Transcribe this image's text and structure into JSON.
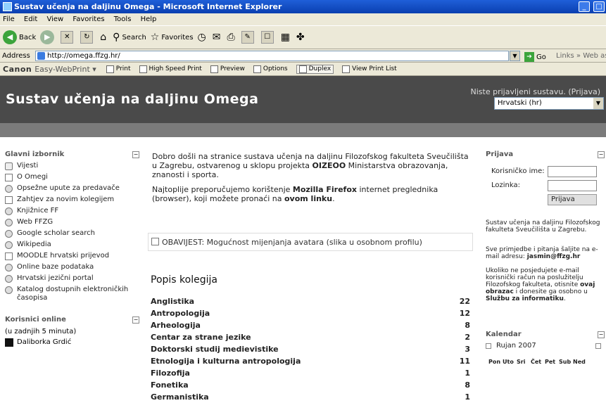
{
  "browser": {
    "title": "Sustav učenja na daljinu Omega - Microsoft Internet Explorer",
    "menu": [
      "File",
      "Edit",
      "View",
      "Favorites",
      "Tools",
      "Help"
    ],
    "toolbar": {
      "back": "Back",
      "search": "Search",
      "favorites": "Favorites"
    },
    "address_label": "Address",
    "address_value": "http://omega.ffzg.hr/",
    "go_label": "Go",
    "links_label": "Links",
    "web_assistant": "Web assistant"
  },
  "canon": {
    "brand": "Canon",
    "product": "Easy-WebPrint",
    "buttons": [
      "Print",
      "High Speed Print",
      "Preview",
      "Options",
      "Duplex",
      "View Print List"
    ]
  },
  "site": {
    "title": "Sustav učenja na daljinu Omega",
    "login_status": "Niste prijavljeni sustavu.",
    "login_link": "(Prijava)",
    "language": "Hrvatski (hr)"
  },
  "main_menu": {
    "title": "Glavni izbornik",
    "items": [
      {
        "label": "Vijesti",
        "icon": "forum-icon"
      },
      {
        "label": "O Omegi",
        "icon": "document-icon"
      },
      {
        "label": "Opsežne upute za predavače",
        "icon": "globe-icon"
      },
      {
        "label": "Zahtjev za novim kolegijem",
        "icon": "document-icon"
      },
      {
        "label": "Knjižnice FF",
        "icon": "globe-icon"
      },
      {
        "label": "Web FFZG",
        "icon": "globe-icon"
      },
      {
        "label": "Google scholar search",
        "icon": "globe-icon"
      },
      {
        "label": "Wikipedia",
        "icon": "globe-icon"
      },
      {
        "label": "MOODLE hrvatski prijevod",
        "icon": "document-icon"
      },
      {
        "label": "Online baze podataka",
        "icon": "globe-icon"
      },
      {
        "label": "Hrvatski jezični portal",
        "icon": "globe-icon"
      },
      {
        "label": "Katalog dostupnih elektroničkih časopisa",
        "icon": "globe-icon"
      }
    ]
  },
  "online_users": {
    "title": "Korisnici online",
    "note": "(u zadnjih 5 minuta)",
    "users": [
      "Daliborka Grdić"
    ]
  },
  "welcome": {
    "p1_start": "Dobro došli na stranice sustava učenja na daljinu Filozofskog fakulteta Sveučilišta u Zagrebu, ostvarenog u sklopu projekta ",
    "p1_bold": "OIZEOO",
    "p1_end": " Ministarstva obrazovanja, znanosti i sporta.",
    "p2_start": "Najtoplije preporučujemo korištenje ",
    "p2_bold1": "Mozilla Firefox",
    "p2_mid": " internet preglednika (browser), koji možete pronaći na ",
    "p2_bold2": "ovom linku",
    "p2_end": "."
  },
  "notice": "OBAVIJEST: Mogućnost mijenjanja avatara (slika u osobnom profilu)",
  "courses": {
    "title": "Popis kolegija",
    "items": [
      {
        "name": "Anglistika",
        "count": "22"
      },
      {
        "name": "Antropologija",
        "count": "12"
      },
      {
        "name": "Arheologija",
        "count": "8"
      },
      {
        "name": "Centar za strane jezike",
        "count": "2"
      },
      {
        "name": "Doktorski studij medievistike",
        "count": "3"
      },
      {
        "name": "Etnologija i kulturna antropologija",
        "count": "11"
      },
      {
        "name": "Filozofija",
        "count": "1"
      },
      {
        "name": "Fonetika",
        "count": "8"
      },
      {
        "name": "Germanistika",
        "count": "1"
      }
    ]
  },
  "login_block": {
    "title": "Prijava",
    "username_label": "Korisničko ime:",
    "password_label": "Lozinka:",
    "button": "Prijava"
  },
  "info": {
    "about": "Sustav učenja na daljinu Filozofskog fakulteta Sveučilišta u Zagrebu.",
    "contact_start": "Sve primjedbe i pitanja šaljite na e-mail adresu: ",
    "contact_email": "jasmin@ffzg.hr",
    "account_start": "Ukoliko ne posjedujete e-mail korisnički račun na poslužitelju Filozofskog fakulteta, otisnite ",
    "account_bold": "ovaj obrazac",
    "account_mid": " i donesite ga osobno u ",
    "account_bold2": "Službu za informatiku",
    "account_end": "."
  },
  "calendar": {
    "title": "Kalendar",
    "month": "Rujan 2007",
    "days": [
      "Pon",
      "Uto",
      "Sri",
      "Čet",
      "Pet",
      "Sub",
      "Ned"
    ]
  }
}
